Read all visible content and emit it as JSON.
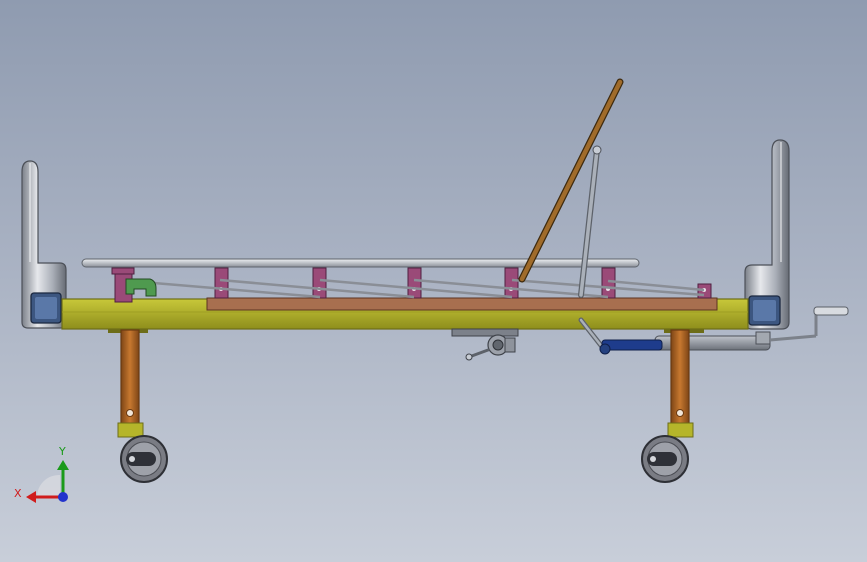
{
  "viewport": {
    "background_top": "#8f9bb0",
    "background_bottom": "#c8ced9"
  },
  "colors": {
    "frame": "#b5b52a",
    "frame_edge": "#6d6d18",
    "leg": "#b8692a",
    "leg_edge": "#6a3a12",
    "rail": "#c9ccd1",
    "bracket": "#9a4a78",
    "slat": "#8d5a3a",
    "headboard": "#c7cbd2",
    "panel": "#3c5680",
    "actuator": "#1e3c8c",
    "caster": "#6f7078",
    "axis_x": "#d01c1c",
    "axis_y": "#1a9a1a",
    "axis_z": "#2233cc",
    "backrest": "#8a5a22",
    "clip": "#4f9a4f"
  },
  "triad": {
    "x_label": "X",
    "y_label": "Y"
  }
}
